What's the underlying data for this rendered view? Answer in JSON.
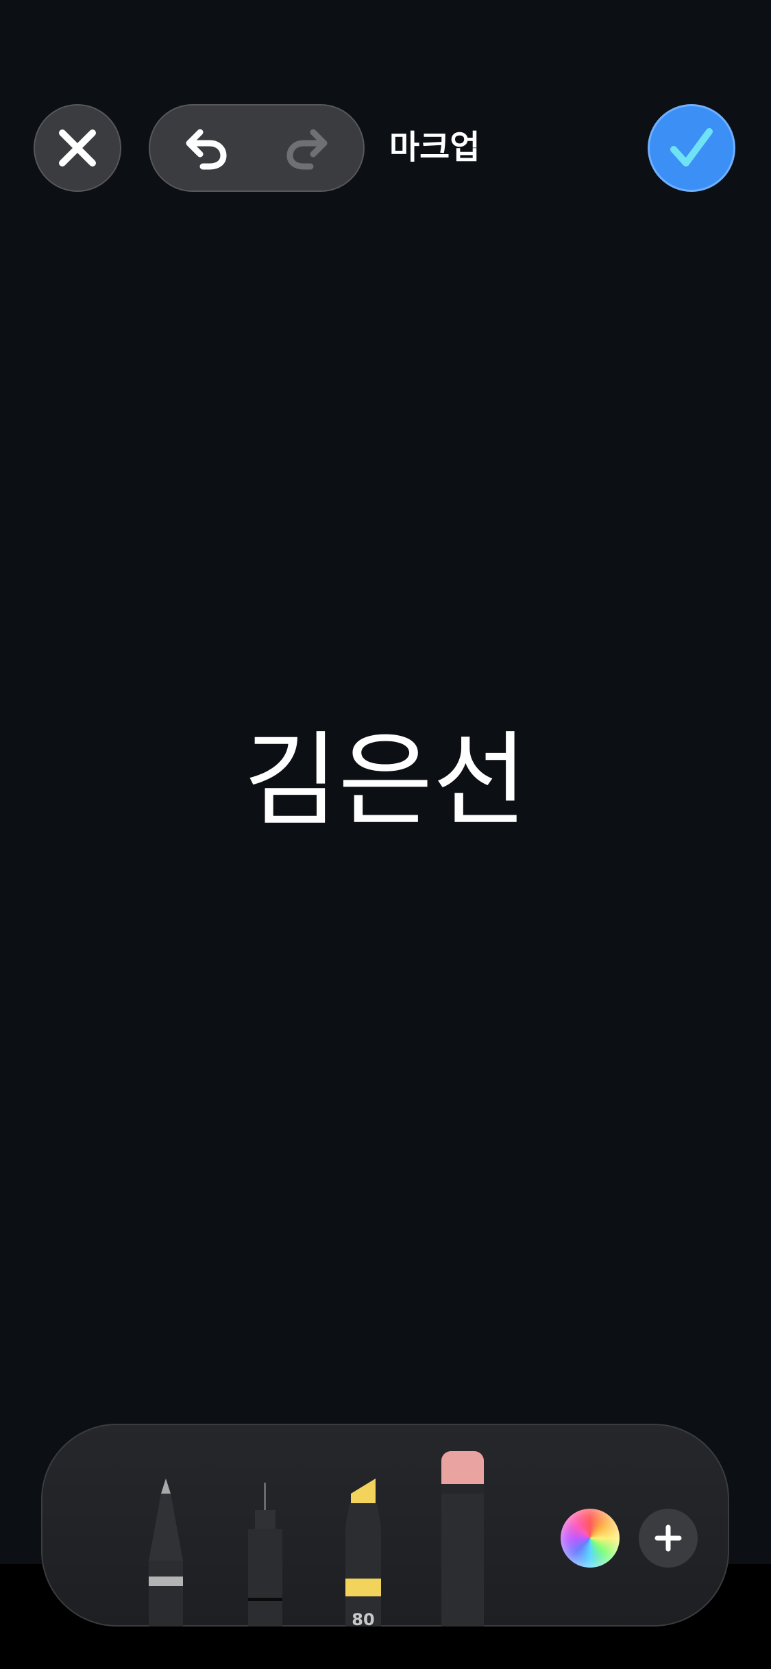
{
  "header": {
    "title": "마크업",
    "close_icon": "close-icon",
    "undo_icon": "undo-icon",
    "redo_icon": "redo-icon",
    "done_icon": "checkmark-icon"
  },
  "canvas": {
    "text": "김은선"
  },
  "tool_palette": {
    "tools": [
      {
        "name": "pen",
        "icon": "pen-icon",
        "selected": false
      },
      {
        "name": "fineliner",
        "icon": "fineliner-icon",
        "selected": false
      },
      {
        "name": "marker",
        "icon": "marker-icon",
        "label": "80",
        "color": "#f2d35b",
        "selected": false
      },
      {
        "name": "eraser",
        "icon": "eraser-icon",
        "color": "#e9a3a0",
        "selected": false
      }
    ],
    "color_picker_icon": "color-wheel-icon",
    "add_icon": "plus-icon"
  },
  "colors": {
    "background": "#0c0f14",
    "accent": "#3b8ff5",
    "checkmark": "#6fe3f5",
    "button_bg": "#3a3c40"
  }
}
